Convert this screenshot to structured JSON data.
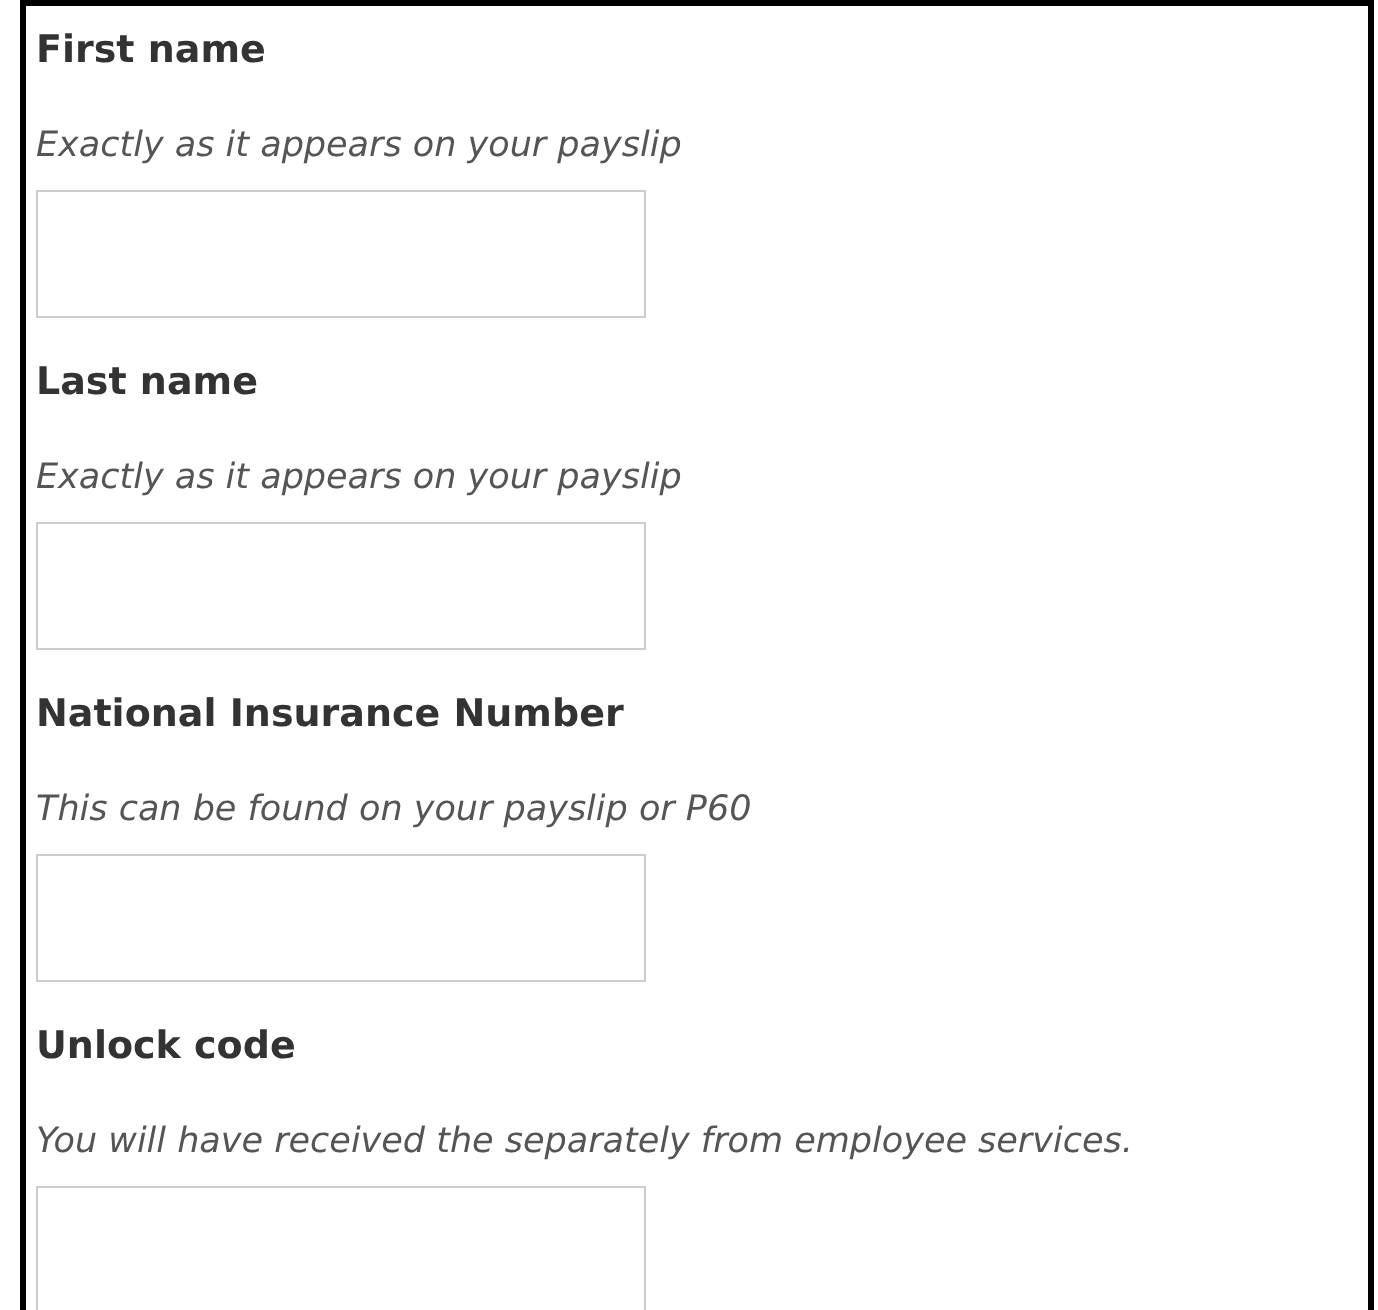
{
  "fields": [
    {
      "label": "First name",
      "hint": "Exactly as it appears on your payslip"
    },
    {
      "label": "Last name",
      "hint": "Exactly as it appears on your payslip"
    },
    {
      "label": "National Insurance Number",
      "hint": "This can be found on your payslip or P60"
    },
    {
      "label": "Unlock code",
      "hint": "You will have received the separately from employee services."
    }
  ]
}
